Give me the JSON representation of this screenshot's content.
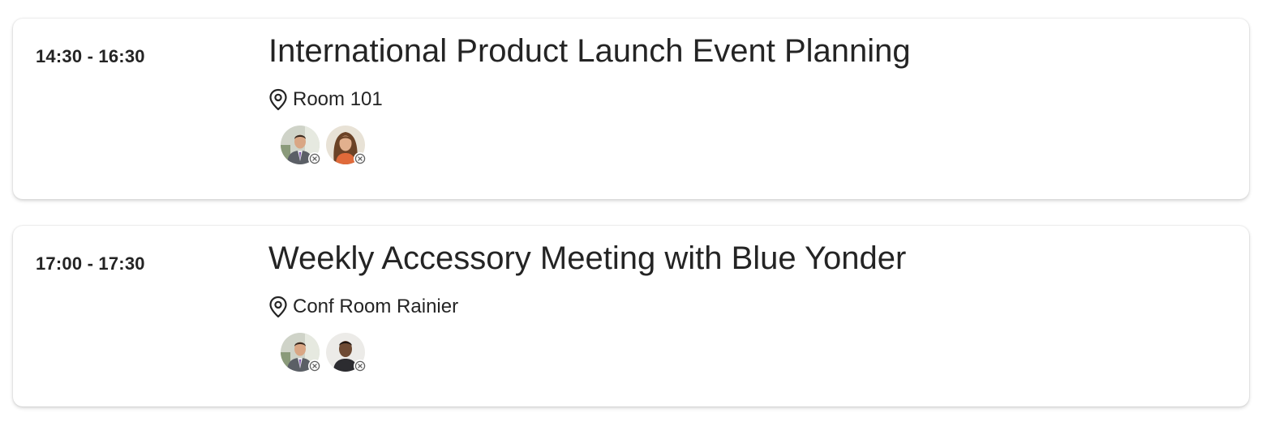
{
  "events": [
    {
      "time": "14:30 - 16:30",
      "title": "International Product Launch Event Planning",
      "location": "Room 101",
      "attendees": [
        {
          "name": "attendee-man-suit",
          "status": "unknown"
        },
        {
          "name": "attendee-woman-brown-hair",
          "status": "unknown"
        }
      ]
    },
    {
      "time": "17:00 - 17:30",
      "title": "Weekly Accessory Meeting with Blue Yonder",
      "location": "Conf Room Rainier",
      "attendees": [
        {
          "name": "attendee-man-suit",
          "status": "unknown"
        },
        {
          "name": "attendee-man-dark-shirt",
          "status": "unknown"
        }
      ]
    }
  ],
  "icons": {
    "location": "location-pin-icon",
    "status": "status-unknown-icon"
  },
  "colors": {
    "text": "#242424",
    "card_bg": "#ffffff",
    "status_ring": "#616161"
  }
}
